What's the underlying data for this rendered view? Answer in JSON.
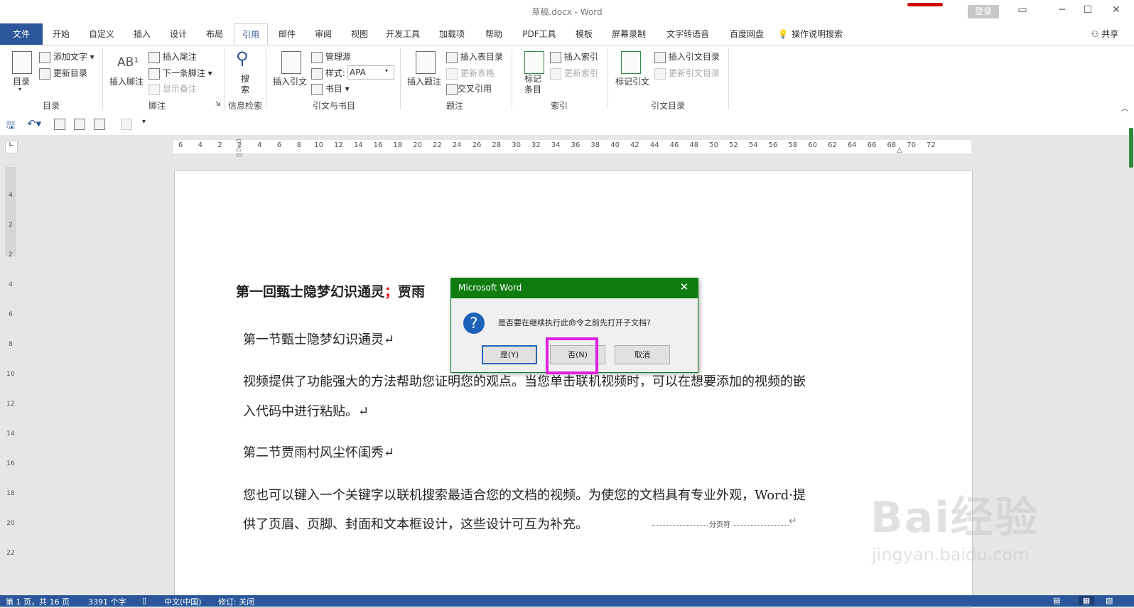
{
  "title_bar": {
    "doc_title": "草稿.docx - Word",
    "login": "登录",
    "controls": [
      "▭",
      "─",
      "☐",
      "✕"
    ]
  },
  "tabs": [
    "文件",
    "开始",
    "自定义",
    "插入",
    "设计",
    "布局",
    "引用",
    "邮件",
    "审阅",
    "视图",
    "开发工具",
    "加载项",
    "帮助",
    "PDF工具",
    "模板",
    "屏幕录制",
    "文字转语音",
    "百度网盘"
  ],
  "tell_me": "操作说明搜索",
  "share": "共享",
  "ribbon": {
    "toc": {
      "big": "目录",
      "add_text": "添加文字",
      "update": "更新目录",
      "group": "目录"
    },
    "footnote": {
      "insert_footnote": "插入脚注",
      "insert_endnote": "插入尾注",
      "next_footnote": "下一条脚注",
      "show_notes": "显示备注",
      "group": "脚注"
    },
    "research": {
      "search": "搜\n索",
      "group": "信息检索"
    },
    "citations": {
      "insert_citation": "插入引文",
      "manage_sources": "管理源",
      "style_label": "样式:",
      "style_value": "APA",
      "bibliography": "书目",
      "group": "引文与书目"
    },
    "captions": {
      "insert_caption": "插入题注",
      "insert_tof": "插入表目录",
      "update_table": "更新表格",
      "cross_ref": "交叉引用",
      "group": "题注"
    },
    "index": {
      "mark_entry": "标记\n条目",
      "insert_index": "插入索引",
      "update_index": "更新索引",
      "group": "索引"
    },
    "toa": {
      "mark_citation": "标记引文",
      "insert_toa": "插入引文目录",
      "update_toa": "更新引文目录",
      "group": "引文目录"
    }
  },
  "ruler": {
    "h_numbers": [
      "6",
      "4",
      "2",
      "2",
      "4",
      "6",
      "8",
      "10",
      "12",
      "14",
      "16",
      "18",
      "20",
      "22",
      "24",
      "26",
      "28",
      "30",
      "32",
      "34",
      "36",
      "38",
      "40",
      "42",
      "44",
      "46",
      "48",
      "50",
      "52",
      "54",
      "56",
      "58",
      "60",
      "62",
      "64",
      "66",
      "68",
      "70",
      "72"
    ],
    "v_numbers": [
      "4",
      "2",
      "2",
      "4",
      "6",
      "8",
      "10",
      "12",
      "14",
      "16",
      "18",
      "20",
      "22"
    ]
  },
  "document": {
    "heading1_a": "第一回甄士隐梦幻识通灵",
    "heading1_sep": "；",
    "heading1_b": "贾雨",
    "heading2_1": "第一节甄士隐梦幻识通灵↵",
    "para1_line1": "视频提供了功能强大的方法帮助您证明您的观点。当您单击联机视频时，可以在想要添加的视频的嵌",
    "para1_line2": "入代码中进行粘贴。↵",
    "heading2_2": "第二节贾雨村风尘怀闺秀↵",
    "para2_line1": "您也可以键入一个关键字以联机搜索最适合您的文档的视频。为使您的文档具有专业外观，Word·提",
    "para2_line2": "供了页眉、页脚、封面和文本框设计，这些设计可互为补充。",
    "page_break": "分页符",
    "return_mark": "↵"
  },
  "dialog": {
    "title": "Microsoft Word",
    "message": "是否要在继续执行此命令之前先打开子文档?",
    "yes": "是(Y)",
    "no": "否(N)",
    "cancel": "取消",
    "highlight_color": "#e020e0"
  },
  "status_bar": {
    "page": "第 1 页，共 16 页",
    "words": "3391 个字",
    "language": "中文(中国)",
    "track": "修订: 关闭"
  },
  "watermark": {
    "brand": "Bai经验",
    "url": "jingyan.baidu.com"
  },
  "colors": {
    "accent": "#2b579a",
    "dialog_title": "#107c10"
  }
}
